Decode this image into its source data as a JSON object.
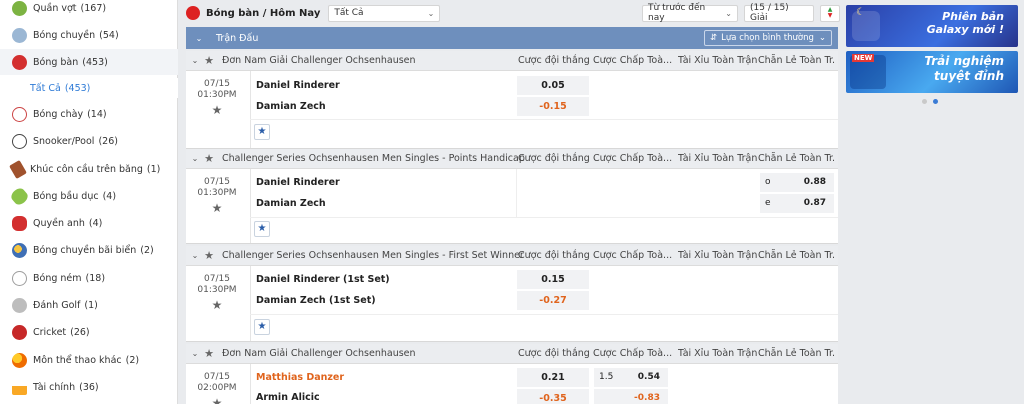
{
  "sidebar": {
    "items": [
      {
        "label": "Quần vợt",
        "count": "(167)",
        "icon": "tennis-icon",
        "color": "#7cb342"
      },
      {
        "label": "Bóng chuyền",
        "count": "(54)",
        "icon": "volleyball-icon",
        "color": "#9bb7d4"
      },
      {
        "label": "Bóng bàn",
        "count": "(453)",
        "icon": "table-tennis-icon",
        "color": "#d32f2f"
      },
      {
        "label": "Bóng chày",
        "count": "(14)",
        "icon": "baseball-icon",
        "color": "#cc4444"
      },
      {
        "label": "Snooker/Pool",
        "count": "(26)",
        "icon": "snooker-icon",
        "color": "#444444"
      },
      {
        "label": "Khúc côn cầu trên băng",
        "count": "(1)",
        "icon": "ice-hockey-icon",
        "color": "#a0522d"
      },
      {
        "label": "Bóng bầu dục",
        "count": "(4)",
        "icon": "rugby-icon",
        "color": "#8bc34a"
      },
      {
        "label": "Quyền anh",
        "count": "(4)",
        "icon": "boxing-icon",
        "color": "#d32f2f"
      },
      {
        "label": "Bóng chuyền bãi biển",
        "count": "(2)",
        "icon": "beach-volleyball-icon",
        "color": "#3f6fb5"
      },
      {
        "label": "Bóng ném",
        "count": "(18)",
        "icon": "handball-icon",
        "color": "#9e9e9e"
      },
      {
        "label": "Đánh Golf",
        "count": "(1)",
        "icon": "golf-icon",
        "color": "#9e9e9e"
      },
      {
        "label": "Cricket",
        "count": "(26)",
        "icon": "cricket-icon",
        "color": "#c62828"
      },
      {
        "label": "Môn thể thao khác",
        "count": "(2)",
        "icon": "other-sports-icon",
        "color": "#ef6c00"
      },
      {
        "label": "Tài chính",
        "count": "(36)",
        "icon": "finance-icon",
        "color": "#f9a825"
      }
    ],
    "sub": {
      "label": "Tất Cả",
      "count": "(453)"
    }
  },
  "topbar": {
    "title": "Bóng bàn / Hôm Nay",
    "filter": "Tất Cả",
    "time_filter": "Từ trước đến nay",
    "counter": "(15 / 15) Giải"
  },
  "header": {
    "title": "Trận Đấu",
    "sort_label": "Lựa chọn bình thường"
  },
  "columns": [
    "Cược đội thắng",
    "Cược Chấp Toà...",
    "Tài Xỉu Toàn Trận",
    "Chẵn Lẻ Toàn Tr..."
  ],
  "events": [
    {
      "league": "Đơn Nam Giải Challenger Ochsenhausen",
      "date": "07/15",
      "time": "01:30PM",
      "team1": "Daniel Rinderer",
      "team2": "Damian Zech",
      "ml1": "0.05",
      "ml2": "-0.15"
    },
    {
      "league": "Challenger Series Ochsenhausen Men Singles - Points Handicap",
      "date": "07/15",
      "time": "01:30PM",
      "team1": "Daniel Rinderer",
      "team2": "Damian Zech",
      "oe1_key": "o",
      "oe1": "0.88",
      "oe2_key": "e",
      "oe2": "0.87"
    },
    {
      "league": "Challenger Series Ochsenhausen Men Singles - First Set Winner",
      "date": "07/15",
      "time": "01:30PM",
      "team1": "Daniel Rinderer (1st Set)",
      "team2": "Damian Zech (1st Set)",
      "ml1": "0.15",
      "ml2": "-0.27"
    },
    {
      "league": "Đơn Nam Giải Challenger Ochsenhausen",
      "date": "07/15",
      "time": "02:00PM",
      "team1": "Matthias Danzer",
      "team2": "Armin Alicic",
      "ml1": "0.21",
      "ml2": "-0.35",
      "hc_line": "1.5",
      "hc1": "0.54",
      "hc2": "-0.83"
    }
  ],
  "banners": [
    {
      "line1": "Phiên bản",
      "line2": "Galaxy mới !"
    },
    {
      "line1": "Trải nghiệm",
      "line2": "tuyệt đỉnh"
    }
  ],
  "colors": {
    "accent": "#6e8fbd",
    "negative": "#e0641d",
    "link": "#2f7bd6"
  }
}
